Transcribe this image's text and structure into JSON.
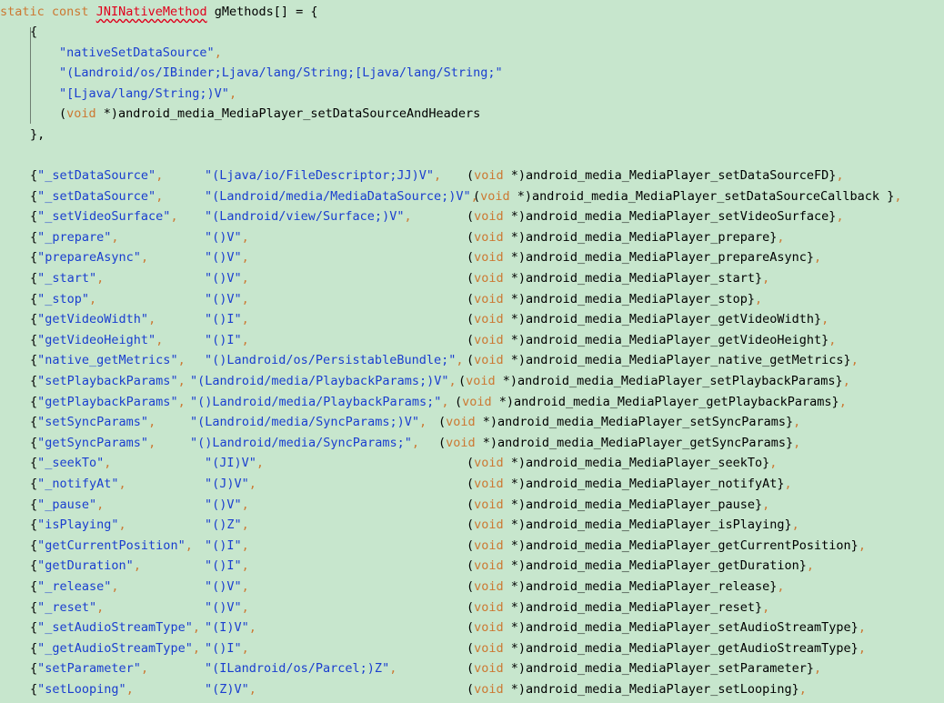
{
  "header": {
    "kw_static": "static",
    "kw_const": "const",
    "type_name": "JNINativeMethod",
    "decl_rest": "gMethods[] = {"
  },
  "first_block": {
    "open": "{",
    "name": "\"nativeSetDataSource\"",
    "sig_line1": "\"(Landroid/os/IBinder;Ljava/lang/String;[Ljava/lang/String;\"",
    "sig_line2": "\"[Ljava/lang/String;)V\"",
    "cast_open": "(",
    "cast_kw": "void",
    "func": " *)android_media_MediaPlayer_setDataSourceAndHeaders",
    "close": "},"
  },
  "entries": [
    {
      "name": "\"_setDataSource\"",
      "sig": "\"(Ljava/io/FileDescriptor;JJ)V\"",
      "func": "android_media_MediaPlayer_setDataSourceFD",
      "close": "}"
    },
    {
      "name": "\"_setDataSource\"",
      "sig": "\"(Landroid/media/MediaDataSource;)V\"",
      "func": "android_media_MediaPlayer_setDataSourceCallback",
      "close": " }"
    },
    {
      "name": "\"_setVideoSurface\"",
      "sig": "\"(Landroid/view/Surface;)V\"",
      "func": "android_media_MediaPlayer_setVideoSurface",
      "close": "}"
    },
    {
      "name": "\"_prepare\"",
      "sig": "\"()V\"",
      "func": "android_media_MediaPlayer_prepare",
      "close": "}"
    },
    {
      "name": "\"prepareAsync\"",
      "sig": "\"()V\"",
      "func": "android_media_MediaPlayer_prepareAsync",
      "close": "}"
    },
    {
      "name": "\"_start\"",
      "sig": "\"()V\"",
      "func": "android_media_MediaPlayer_start",
      "close": "}"
    },
    {
      "name": "\"_stop\"",
      "sig": "\"()V\"",
      "func": "android_media_MediaPlayer_stop",
      "close": "}"
    },
    {
      "name": "\"getVideoWidth\"",
      "sig": "\"()I\"",
      "func": "android_media_MediaPlayer_getVideoWidth",
      "close": "}"
    },
    {
      "name": "\"getVideoHeight\"",
      "sig": "\"()I\"",
      "func": "android_media_MediaPlayer_getVideoHeight",
      "close": "}"
    },
    {
      "name": "\"native_getMetrics\"",
      "sig": "\"()Landroid/os/PersistableBundle;\"",
      "func": "android_media_MediaPlayer_native_getMetrics",
      "close": "}"
    },
    {
      "name": "\"setPlaybackParams\"",
      "sig": "\"(Landroid/media/PlaybackParams;)V\"",
      "func": "android_media_MediaPlayer_setPlaybackParams",
      "close": "}"
    },
    {
      "name": "\"getPlaybackParams\"",
      "sig": "\"()Landroid/media/PlaybackParams;\"",
      "func": "android_media_MediaPlayer_getPlaybackParams",
      "close": "}"
    },
    {
      "name": "\"setSyncParams\"",
      "sig": "\"(Landroid/media/SyncParams;)V\"",
      "func": "android_media_MediaPlayer_setSyncParams",
      "close": "}"
    },
    {
      "name": "\"getSyncParams\"",
      "sig": "\"()Landroid/media/SyncParams;\"",
      "func": "android_media_MediaPlayer_getSyncParams",
      "close": "}"
    },
    {
      "name": "\"_seekTo\"",
      "sig": "\"(JI)V\"",
      "func": "android_media_MediaPlayer_seekTo",
      "close": "}"
    },
    {
      "name": "\"_notifyAt\"",
      "sig": "\"(J)V\"",
      "func": "android_media_MediaPlayer_notifyAt",
      "close": "}"
    },
    {
      "name": "\"_pause\"",
      "sig": "\"()V\"",
      "func": "android_media_MediaPlayer_pause",
      "close": "}"
    },
    {
      "name": "\"isPlaying\"",
      "sig": "\"()Z\"",
      "func": "android_media_MediaPlayer_isPlaying",
      "close": "}"
    },
    {
      "name": "\"getCurrentPosition\"",
      "sig": "\"()I\"",
      "func": "android_media_MediaPlayer_getCurrentPosition",
      "close": "}"
    },
    {
      "name": "\"getDuration\"",
      "sig": "\"()I\"",
      "func": "android_media_MediaPlayer_getDuration",
      "close": "}"
    },
    {
      "name": "\"_release\"",
      "sig": "\"()V\"",
      "func": "android_media_MediaPlayer_release",
      "close": "}"
    },
    {
      "name": "\"_reset\"",
      "sig": "\"()V\"",
      "func": "android_media_MediaPlayer_reset",
      "close": "}"
    },
    {
      "name": "\"_setAudioStreamType\"",
      "sig": "\"(I)V\"",
      "func": "android_media_MediaPlayer_setAudioStreamType",
      "close": "}"
    },
    {
      "name": "\"_getAudioStreamType\"",
      "sig": "\"()I\"",
      "func": "android_media_MediaPlayer_getAudioStreamType",
      "close": "}"
    },
    {
      "name": "\"setParameter\"",
      "sig": "\"(ILandroid/os/Parcel;)Z\"",
      "func": "android_media_MediaPlayer_setParameter",
      "close": "}"
    },
    {
      "name": "\"setLooping\"",
      "sig": "\"(Z)V\"",
      "func": "android_media_MediaPlayer_setLooping",
      "close": "}"
    }
  ],
  "tokens": {
    "open_brace": "{",
    "comma": ",",
    "cast_open": "(",
    "cast_kw": "void",
    "cast_close": " *)"
  },
  "colors": {
    "background": "#c7e6cd",
    "keyword": "#cc7832",
    "string": "#1a3ecf",
    "error_type": "#e0001c",
    "text": "#000000"
  }
}
